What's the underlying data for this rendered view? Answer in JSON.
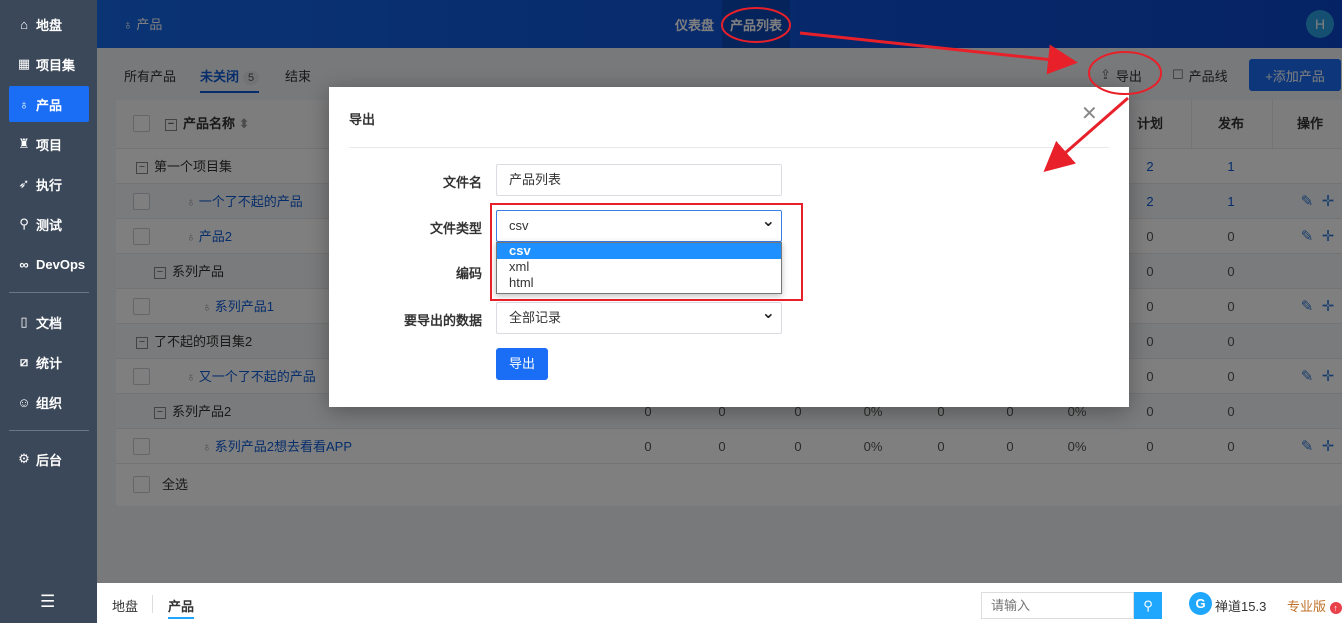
{
  "sidebar": {
    "items": [
      {
        "label": "地盘",
        "icon": "home-icon"
      },
      {
        "label": "项目集",
        "icon": "grid-icon"
      },
      {
        "label": "产品",
        "icon": "lightbulb-icon",
        "active": true
      },
      {
        "label": "项目",
        "icon": "rocket-icon"
      },
      {
        "label": "执行",
        "icon": "run-icon"
      },
      {
        "label": "测试",
        "icon": "search-icon"
      },
      {
        "label": "DevOps",
        "icon": "infinity-icon"
      },
      {
        "label": "文档",
        "icon": "book-icon"
      },
      {
        "label": "统计",
        "icon": "chart-icon"
      },
      {
        "label": "组织",
        "icon": "users-icon"
      },
      {
        "label": "后台",
        "icon": "gear-icon"
      }
    ],
    "collapse_icon": "menu-collapse-icon"
  },
  "header": {
    "module": "产品",
    "nav": [
      "仪表盘",
      "产品列表"
    ],
    "avatar": "H"
  },
  "tabs": [
    {
      "label": "所有产品"
    },
    {
      "label": "未关闭",
      "count": "5"
    },
    {
      "label": "结束"
    }
  ],
  "toolbar": {
    "export": "导出",
    "product_line": "产品线",
    "add_product": "+添加产品"
  },
  "table": {
    "headers": {
      "name": "产品名称",
      "plan": "计划",
      "release": "发布",
      "actions": "操作"
    },
    "rows": [
      {
        "type": "group",
        "level": 0,
        "name": "第一个项目集",
        "plan": "2",
        "release": "1"
      },
      {
        "type": "product",
        "level": 1,
        "name": "一个了不起的产品",
        "plan": "2",
        "release": "1",
        "actions": true
      },
      {
        "type": "product",
        "level": 1,
        "name": "产品2",
        "plan": "0",
        "release": "0",
        "actions": true
      },
      {
        "type": "group",
        "level": 1,
        "name": "系列产品",
        "plan": "0",
        "release": "0"
      },
      {
        "type": "product",
        "level": 2,
        "name": "系列产品1",
        "plan": "0",
        "release": "0",
        "actions": true
      },
      {
        "type": "group",
        "level": 0,
        "name": "了不起的项目集2",
        "plan": "0",
        "release": "0"
      },
      {
        "type": "product",
        "level": 1,
        "name": "又一个了不起的产品",
        "plan": "0",
        "release": "0",
        "actions": true
      },
      {
        "type": "group",
        "level": 1,
        "name": "系列产品2",
        "cols": [
          "0",
          "0",
          "0",
          "0%",
          "0",
          "0",
          "0%"
        ],
        "plan": "0",
        "release": "0"
      },
      {
        "type": "product",
        "level": 2,
        "name": "系列产品2想去看看APP",
        "cols": [
          "0",
          "0",
          "0",
          "0%",
          "0",
          "0",
          "0%"
        ],
        "plan": "0",
        "release": "0",
        "actions": true
      }
    ],
    "select_all": "全选"
  },
  "modal": {
    "title": "导出",
    "close": "✕",
    "file_name_label": "文件名",
    "file_name_value": "产品列表",
    "file_type_label": "文件类型",
    "file_type_value": "csv",
    "file_type_options": [
      "csv",
      "xml",
      "html"
    ],
    "encoding_label": "编码",
    "data_label": "要导出的数据",
    "data_value": "全部记录",
    "submit": "导出"
  },
  "bottombar": {
    "breadcrumbs": [
      "地盘",
      "产品"
    ],
    "search_placeholder": "请输入",
    "version": "禅道15.3",
    "edition": "专业版"
  },
  "colors": {
    "primary": "#1a6ef5",
    "sidebar": "#3b4859",
    "annotation": "#e8202a"
  }
}
